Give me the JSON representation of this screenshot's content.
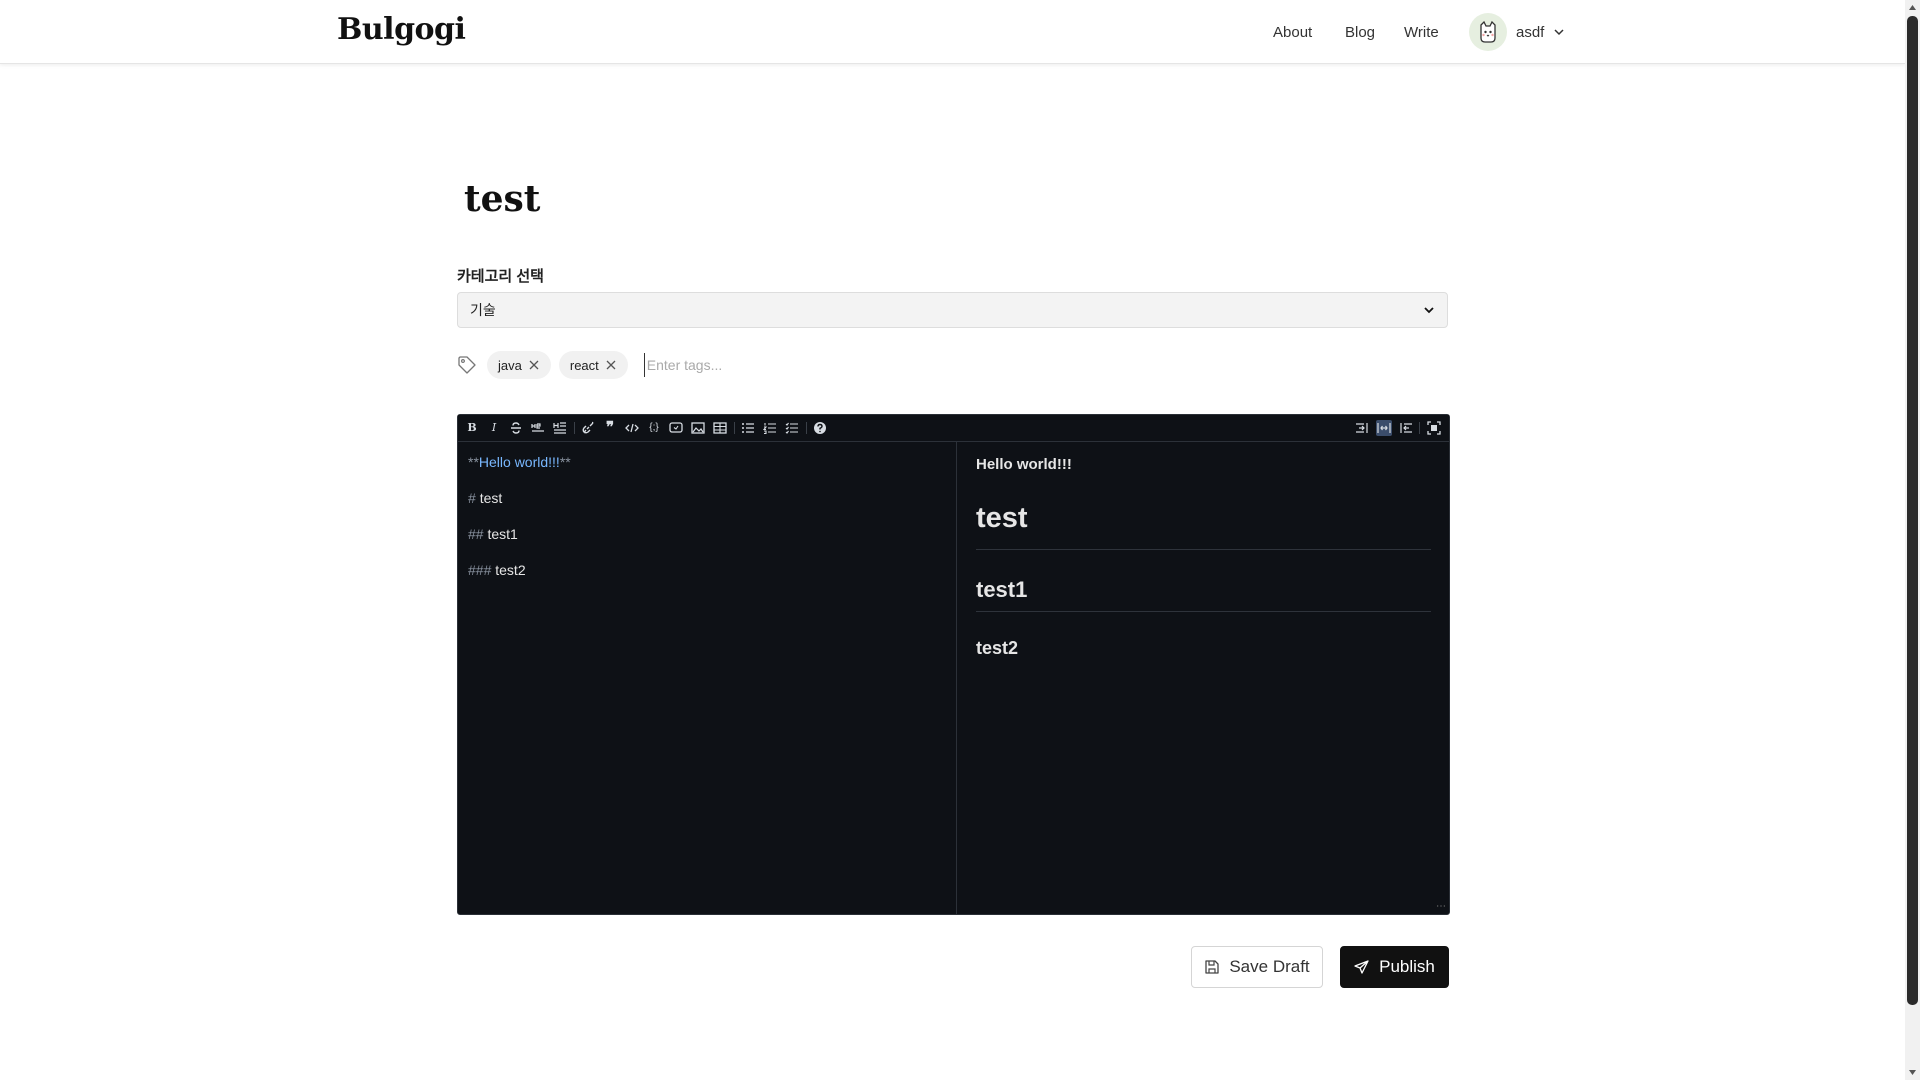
{
  "header": {
    "brand": "Bulgogi",
    "nav": [
      {
        "label": "About"
      },
      {
        "label": "Blog"
      },
      {
        "label": "Write"
      }
    ],
    "user": {
      "name": "asdf"
    }
  },
  "post": {
    "title": "test",
    "category": {
      "label": "카테고리 선택",
      "selected": "기술"
    },
    "tags": {
      "items": [
        "java",
        "react"
      ],
      "placeholder": "Enter tags..."
    }
  },
  "editor": {
    "source_lines": [
      {
        "mark_open": "**",
        "text": "Hello world!!!",
        "mark_close": "**"
      },
      {
        "mark": "# ",
        "text": "test"
      },
      {
        "mark": "## ",
        "text": "test1"
      },
      {
        "mark": "### ",
        "text": "test2"
      }
    ],
    "preview": {
      "paragraph": "Hello world!!!",
      "h1": "test",
      "h2": "test1",
      "h3": "test2"
    },
    "toolbar_icons": [
      "bold-icon",
      "italic-icon",
      "strikethrough-icon",
      "hr-icon",
      "title-icon",
      "link-icon",
      "quote-icon",
      "code-icon",
      "codeblock-icon",
      "comment-icon",
      "image-icon",
      "table-icon",
      "unordered-list-icon",
      "ordered-list-icon",
      "checked-list-icon",
      "help-icon",
      "edit-mode-icon",
      "live-mode-icon",
      "preview-mode-icon",
      "fullscreen-icon"
    ]
  },
  "actions": {
    "save_draft": "Save Draft",
    "publish": "Publish"
  },
  "colors": {
    "editor_bg": "#0e1116",
    "publish_bg": "#111111",
    "link_bold": "#79b8ff"
  }
}
